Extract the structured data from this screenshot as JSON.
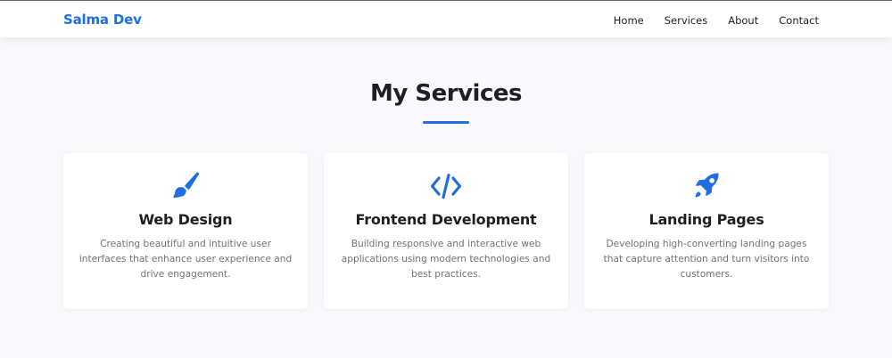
{
  "brand": {
    "name": "Salma Dev"
  },
  "nav": {
    "links": [
      "Home",
      "Services",
      "About",
      "Contact"
    ]
  },
  "services": {
    "title": "My Services",
    "accent_color": "#1f6fe0",
    "cards": [
      {
        "icon": "paintbrush-icon",
        "title": "Web Design",
        "description": "Creating beautiful and intuitive user interfaces that enhance user experience and drive engagement."
      },
      {
        "icon": "code-icon",
        "title": "Frontend Development",
        "description": "Building responsive and interactive web applications using modern technologies and best practices."
      },
      {
        "icon": "rocket-icon",
        "title": "Landing Pages",
        "description": "Developing high-converting landing pages that capture attention and turn visitors into customers."
      }
    ]
  }
}
